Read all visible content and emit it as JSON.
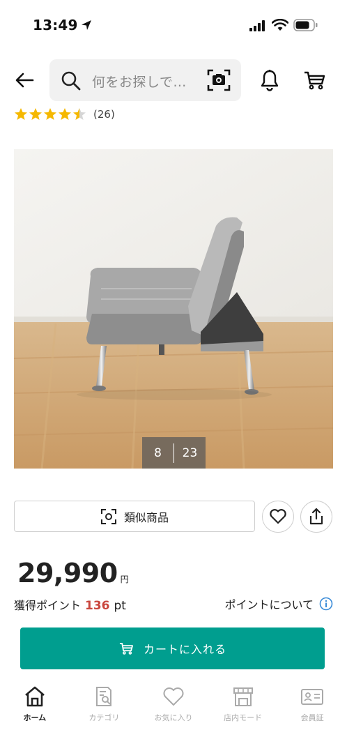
{
  "status_bar": {
    "time": "13:49"
  },
  "header": {
    "search_placeholder": "何をお探しで…"
  },
  "rating": {
    "value": 4.5,
    "max": 5,
    "count": "(26)"
  },
  "gallery": {
    "current": "8",
    "total": "23"
  },
  "actions": {
    "similar_label": "類似商品"
  },
  "price": {
    "value": "29,990",
    "unit": "円"
  },
  "points": {
    "label": "獲得ポイント",
    "value": "136",
    "unit": "pt",
    "about": "ポイントについて"
  },
  "cart_button": {
    "label": "カートに入れる"
  },
  "colors": {
    "accent": "#009e8f",
    "points": "#c9463d",
    "star": "#f5b800",
    "info": "#3a8bd8"
  },
  "tab_bar": {
    "items": [
      {
        "label": "ホーム",
        "icon": "home-icon",
        "active": true
      },
      {
        "label": "カテゴリ",
        "icon": "category-icon",
        "active": false
      },
      {
        "label": "お気に入り",
        "icon": "heart-icon",
        "active": false
      },
      {
        "label": "店内モード",
        "icon": "store-icon",
        "active": false
      },
      {
        "label": "会員証",
        "icon": "member-card-icon",
        "active": false
      }
    ]
  }
}
